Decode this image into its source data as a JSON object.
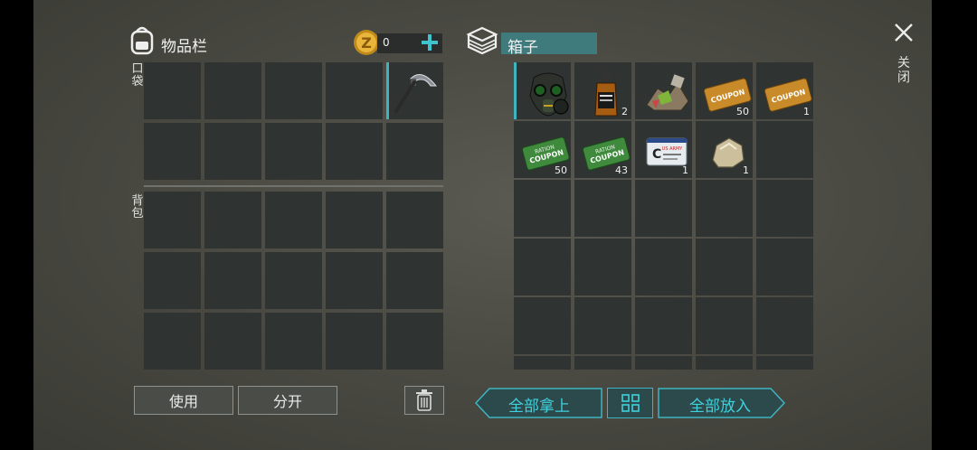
{
  "left": {
    "title": "物品栏",
    "coins": "0",
    "pocket_label": "口袋",
    "backpack_label": "背包",
    "use_label": "使用",
    "split_label": "分开"
  },
  "right": {
    "title": "箱子",
    "take_all_label": "全部拿上",
    "put_all_label": "全部放入",
    "close_label": "关闭"
  },
  "box_items": [
    {
      "name": "gas-mask",
      "count": ""
    },
    {
      "name": "whiskey-bottle",
      "count": "2"
    },
    {
      "name": "scrap-pile",
      "count": ""
    },
    {
      "name": "orange-coupon",
      "count": "50"
    },
    {
      "name": "orange-coupon",
      "count": "1"
    },
    {
      "name": "green-ration-coupon",
      "count": "50"
    },
    {
      "name": "green-ration-coupon",
      "count": "43"
    },
    {
      "name": "army-id-card",
      "count": "1"
    },
    {
      "name": "stone",
      "count": "1"
    }
  ],
  "coupon_text": "COUPON",
  "ration_text": "RATION",
  "id_text": "US ARMY",
  "id_letter": "C",
  "colors": {
    "accent": "#3fb4c0",
    "slot": "#2f3331"
  }
}
